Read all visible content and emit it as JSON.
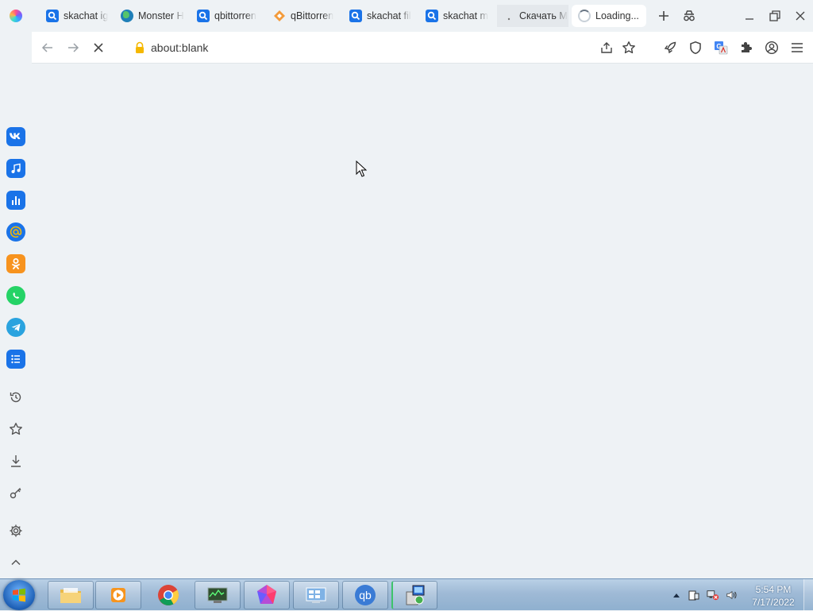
{
  "browser": {
    "tabs": [
      {
        "label": "skachat ig",
        "icon": "search-icon"
      },
      {
        "label": "Monster H",
        "icon": "globe-icon"
      },
      {
        "label": "qbittorren",
        "icon": "search-icon"
      },
      {
        "label": "qBittorren",
        "icon": "diamond-icon"
      },
      {
        "label": "skachat fil",
        "icon": "search-icon"
      },
      {
        "label": "skachat m",
        "icon": "search-icon"
      },
      {
        "label": "Скачать M",
        "icon": "dot-icon"
      },
      {
        "label": "Loading...",
        "icon": "loading-spinner-icon",
        "active": true
      }
    ],
    "address": {
      "url": "about:blank",
      "lock_color": "#f5b800"
    },
    "accent": "#1a73e8"
  },
  "sidebar": {
    "apps": [
      {
        "name": "vk",
        "icon": "vk-icon",
        "color": "#1a73e8"
      },
      {
        "name": "music",
        "icon": "music-note-icon",
        "color": "#1a73e8"
      },
      {
        "name": "stats",
        "icon": "bar-chart-icon",
        "color": "#1a73e8"
      },
      {
        "name": "mail",
        "icon": "at-sign-icon",
        "color": "#1a73e8"
      },
      {
        "name": "odnoklassniki",
        "icon": "ok-icon",
        "color": "#f7931e"
      },
      {
        "name": "whatsapp",
        "icon": "whatsapp-icon",
        "color": "#25d366"
      },
      {
        "name": "telegram",
        "icon": "telegram-icon",
        "color": "#2aa3df"
      },
      {
        "name": "list",
        "icon": "list-icon",
        "color": "#1a73e8"
      }
    ],
    "tools": [
      "history-icon",
      "star-icon",
      "download-icon",
      "key-icon",
      "gear-icon",
      "chevron-up-icon"
    ]
  },
  "taskbar": {
    "apps": [
      "explorer-folder-icon",
      "media-player-icon",
      "chrome-icon",
      "system-monitor-icon",
      "gem-app-icon",
      "control-panel-icon",
      "qbittorrent-icon",
      "installer-icon"
    ],
    "clock": {
      "time": "5:54 PM",
      "date": "7/17/2022"
    }
  }
}
